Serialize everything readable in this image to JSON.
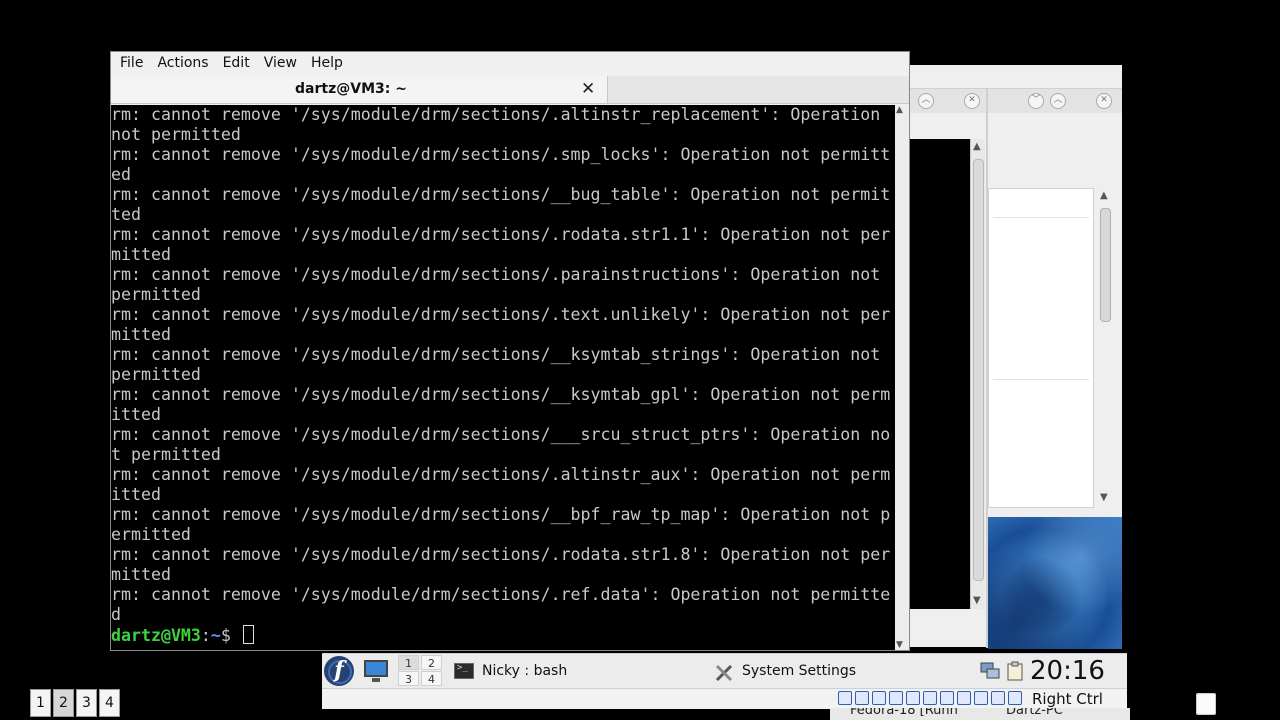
{
  "terminal": {
    "menu": [
      "File",
      "Actions",
      "Edit",
      "View",
      "Help"
    ],
    "tab_title": "dartz@VM3: ~",
    "close_glyph": "✕",
    "lines": [
      "rm: cannot remove '/sys/module/drm/sections/.altinstr_replacement': Operation",
      "not permitted",
      "rm: cannot remove '/sys/module/drm/sections/.smp_locks': Operation not permitt",
      "ed",
      "rm: cannot remove '/sys/module/drm/sections/__bug_table': Operation not permit",
      "ted",
      "rm: cannot remove '/sys/module/drm/sections/.rodata.str1.1': Operation not per",
      "mitted",
      "rm: cannot remove '/sys/module/drm/sections/.parainstructions': Operation not",
      "permitted",
      "rm: cannot remove '/sys/module/drm/sections/.text.unlikely': Operation not per",
      "mitted",
      "rm: cannot remove '/sys/module/drm/sections/__ksymtab_strings': Operation not",
      "permitted",
      "rm: cannot remove '/sys/module/drm/sections/__ksymtab_gpl': Operation not perm",
      "itted",
      "rm: cannot remove '/sys/module/drm/sections/___srcu_struct_ptrs': Operation no",
      "t permitted",
      "rm: cannot remove '/sys/module/drm/sections/.altinstr_aux': Operation not perm",
      "itted",
      "rm: cannot remove '/sys/module/drm/sections/__bpf_raw_tp_map': Operation not p",
      "ermitted",
      "rm: cannot remove '/sys/module/drm/sections/.rodata.str1.8': Operation not per",
      "mitted",
      "rm: cannot remove '/sys/module/drm/sections/.ref.data': Operation not permitte",
      "d"
    ],
    "prompt_user": "dartz@VM3",
    "prompt_sep": ":",
    "prompt_path": "~",
    "prompt_sym": "$ "
  },
  "panel": {
    "pager": [
      "1",
      "2",
      "3",
      "4"
    ],
    "task_terminal": "Nicky : bash",
    "task_settings": "System Settings",
    "clock": "20:16"
  },
  "desktops": [
    "1",
    "2",
    "3",
    "4"
  ],
  "host_key": "Right Ctrl",
  "mini_tasks": [
    "Fedora-18 [Runn",
    "Dartz-PC"
  ],
  "icons": {
    "terminal": "terminal-icon",
    "settings": "tools-icon",
    "fedora": "fedora-logo-icon",
    "show_desktop": "show-desktop-icon"
  },
  "colors": {
    "prompt_user": "#3fd13f",
    "prompt_path": "#6c8cff",
    "terminal_bg": "#000000",
    "terminal_fg": "#c8c8c8"
  }
}
